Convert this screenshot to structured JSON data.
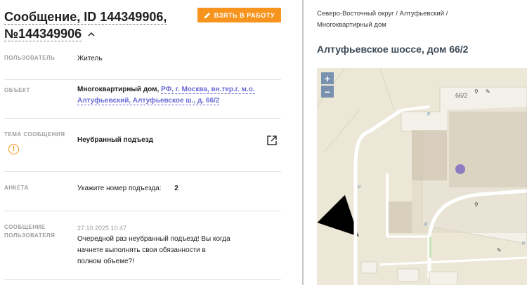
{
  "header": {
    "title_line1": "Сообщение, ID 144349906,",
    "title_line2": "№144349906",
    "collapse_icon": "chevron-up-icon",
    "take_button": "ВЗЯТЬ В РАБОТУ",
    "take_button_icon": "pencil-icon",
    "accent_color": "#f7941d"
  },
  "fields": {
    "user": {
      "label": "ПОЛЬЗОВАТЕЛЬ",
      "value": "Житель"
    },
    "object": {
      "label": "ОБЪЕКТ",
      "value_plain": "Многоквартирный дом,",
      "value_link": "РФ, г. Москва, вн.тер.г. м.о. Алтуфьевский, Алтуфьевское ш., д. 66/2"
    },
    "topic": {
      "label_line1": "ТЕМА",
      "label_line2": "СООБЩЕНИЯ",
      "value": "Неубранный подъезд",
      "icon": "external-link-icon",
      "warn_icon": "warning-icon"
    },
    "form": {
      "label": "АНКЕТА",
      "question": "Укажите номер подъезда:",
      "answer": "2"
    },
    "message": {
      "label_line1": "СООБЩЕНИЕ",
      "label_line2": "ПОЛЬЗОВАТЕЛЯ",
      "timestamp": "27.10.2025 10:47",
      "text": "Очередной раз неубранный подъезд! Вы когда начнете выполнять свои обязанности в полном объеме?!"
    }
  },
  "map_panel": {
    "breadcrumb": "Северо-Восточный округ / Алтуфьевский / Многоквартирный дом",
    "address": "Алтуфьевское шоссе, дом 66/2",
    "zoom_in": "+",
    "zoom_out": "−",
    "building_label": "66/2",
    "parking_label": "P",
    "marker_color": "#8e7cc3"
  }
}
